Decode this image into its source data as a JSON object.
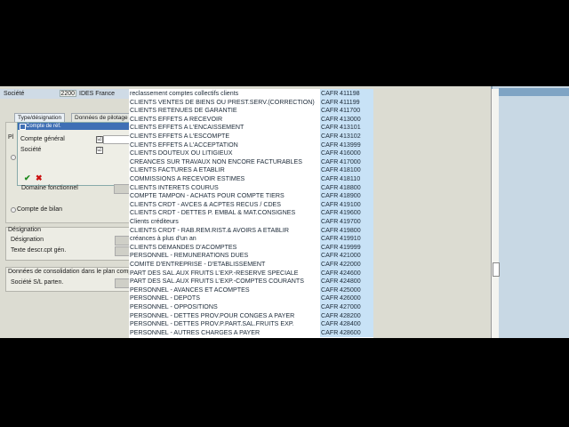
{
  "header": {
    "societe_label": "Société",
    "societe_code": "2200",
    "societe_name": "IDES France"
  },
  "tabs": [
    {
      "label": "Type/désignation"
    },
    {
      "label": "Données de pilotage"
    }
  ],
  "popup": {
    "title": "Compte de réf.",
    "rows": [
      {
        "label": "Compte général",
        "checked": "☑"
      },
      {
        "label": "Société",
        "checked": "☑"
      }
    ]
  },
  "left": {
    "pl_label": "Pl",
    "domaine_label": "Domaine fonctionnel",
    "compte_bilan": "Compte de bilan",
    "designation_group": "Désignation",
    "designation_label": "Désignation",
    "texte_descr_label": "Texte descr.cpt gén.",
    "consolidation_group": "Données de consolidation dans le plan comptable",
    "societe_sl_label": "Société S/L parten."
  },
  "list": [
    {
      "name": "reclassement comptes collectifs clients",
      "cafr": "CAFR",
      "num": "411198"
    },
    {
      "name": "CLIENTS VENTES DE BIENS OU PREST.SERV.(CORRECTION)",
      "cafr": "CAFR",
      "num": "411199"
    },
    {
      "name": "CLIENTS RETENUES DE GARANTIE",
      "cafr": "CAFR",
      "num": "411700"
    },
    {
      "name": "CLIENTS EFFETS A RECEVOIR",
      "cafr": "CAFR",
      "num": "413000"
    },
    {
      "name": "CLIENTS EFFETS A L'ENCAISSEMENT",
      "cafr": "CAFR",
      "num": "413101"
    },
    {
      "name": "CLIENTS EFFETS A L'ESCOMPTE",
      "cafr": "CAFR",
      "num": "413102"
    },
    {
      "name": "CLIENTS EFFETS A L'ACCEPTATION",
      "cafr": "CAFR",
      "num": "413999"
    },
    {
      "name": "CLIENTS DOUTEUX OU LITIGIEUX",
      "cafr": "CAFR",
      "num": "416000"
    },
    {
      "name": "CREANCES SUR TRAVAUX NON ENCORE FACTURABLES",
      "cafr": "CAFR",
      "num": "417000"
    },
    {
      "name": "CLIENTS FACTURES A ETABLIR",
      "cafr": "CAFR",
      "num": "418100"
    },
    {
      "name": "COMMISSIONS A RECEVOIR ESTIMES",
      "cafr": "CAFR",
      "num": "418110"
    },
    {
      "name": "CLIENTS INTERETS COURUS",
      "cafr": "CAFR",
      "num": "418800"
    },
    {
      "name": "COMPTE TAMPON - ACHATS POUR COMPTE TIERS",
      "cafr": "CAFR",
      "num": "418900"
    },
    {
      "name": "CLIENTS CRDT - AVCES & ACPTES RECUS / CDES",
      "cafr": "CAFR",
      "num": "419100"
    },
    {
      "name": "CLIENTS CRDT - DETTES P. EMBAL & MAT.CONSIGNES",
      "cafr": "CAFR",
      "num": "419600"
    },
    {
      "name": "Clients créditeurs",
      "cafr": "CAFR",
      "num": "419700"
    },
    {
      "name": "CLIENTS CRDT - RAB.REM.RIST.& AVOIRS A ETABLIR",
      "cafr": "CAFR",
      "num": "419800"
    },
    {
      "name": "créances à plus d'un an",
      "cafr": "CAFR",
      "num": "419910"
    },
    {
      "name": "CLIENTS DEMANDES D'ACOMPTES",
      "cafr": "CAFR",
      "num": "419999"
    },
    {
      "name": "PERSONNEL - REMUNERATIONS DUES",
      "cafr": "CAFR",
      "num": "421000"
    },
    {
      "name": "COMITE D'ENTREPRISE - D'ETABLISSEMENT",
      "cafr": "CAFR",
      "num": "422000"
    },
    {
      "name": "PART DES SAL.AUX FRUITS L'EXP.-RESERVE SPECIALE",
      "cafr": "CAFR",
      "num": "424600"
    },
    {
      "name": "PART DES SAL.AUX FRUITS L'EXP.-COMPTES COURANTS",
      "cafr": "CAFR",
      "num": "424800"
    },
    {
      "name": "PERSONNEL - AVANCES ET ACOMPTES",
      "cafr": "CAFR",
      "num": "425000"
    },
    {
      "name": "PERSONNEL - DEPOTS",
      "cafr": "CAFR",
      "num": "426000"
    },
    {
      "name": "PERSONNEL - OPPOSITIONS",
      "cafr": "CAFR",
      "num": "427000"
    },
    {
      "name": "PERSONNEL - DETTES PROV.POUR CONGES A PAYER",
      "cafr": "CAFR",
      "num": "428200"
    },
    {
      "name": "PERSONNEL - DETTES PROV.P.PART.SAL.FRUITS EXP.",
      "cafr": "CAFR",
      "num": "428400"
    },
    {
      "name": "PERSONNEL - AUTRES CHARGES A PAYER",
      "cafr": "CAFR",
      "num": "428600"
    }
  ]
}
